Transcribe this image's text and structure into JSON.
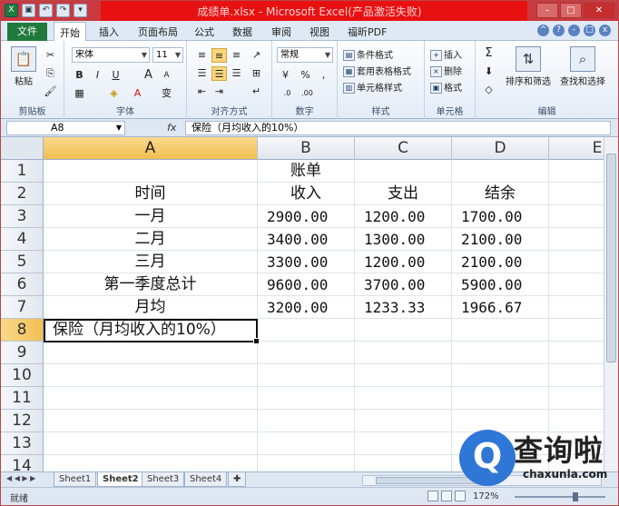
{
  "window": {
    "title": "成绩单.xlsx - Microsoft Excel(产品激活失败)",
    "min_glyph": "–",
    "max_glyph": "□",
    "close_glyph": "✕"
  },
  "qat": {
    "excel_icon": "X",
    "save_icon": "▣",
    "undo_icon": "↶",
    "redo_icon": "↷",
    "more_icon": "▾"
  },
  "tabs": {
    "file": "文件",
    "items": [
      "开始",
      "插入",
      "页面布局",
      "公式",
      "数据",
      "审阅",
      "视图",
      "福昕PDF"
    ],
    "active": "开始"
  },
  "ribbon": {
    "clipboard": {
      "paste": "粘贴",
      "label": "剪贴板"
    },
    "font": {
      "name": "宋体",
      "size": "11",
      "bold": "B",
      "italic": "I",
      "underline": "U",
      "grow": "A",
      "shrink": "A",
      "phonetic": "变",
      "label": "字体"
    },
    "alignment": {
      "label": "对齐方式"
    },
    "number": {
      "format": "常规",
      "percent": "%",
      "comma": ",",
      "label": "数字"
    },
    "styles": {
      "conditional": "条件格式",
      "table": "套用表格格式",
      "cell": "单元格样式",
      "label": "样式"
    },
    "cells": {
      "insert": "插入",
      "delete": "删除",
      "format": "格式",
      "label": "单元格"
    },
    "editing": {
      "sum": "Σ",
      "sort": "排序和筛选",
      "find": "查找和选择",
      "label": "编辑"
    }
  },
  "formula_bar": {
    "name_box": "A8",
    "fx": "fx",
    "content": "保险（月均收入的10%）"
  },
  "sheet": {
    "columns": [
      "A",
      "B",
      "C",
      "D",
      "E"
    ],
    "active_column": "A",
    "active_row": "8",
    "rows": [
      {
        "n": "1",
        "cells": [
          "",
          "账单",
          "",
          "",
          ""
        ]
      },
      {
        "n": "2",
        "cells": [
          "时间",
          "收入",
          "支出",
          "结余",
          ""
        ]
      },
      {
        "n": "3",
        "cells": [
          "一月",
          "2900.00",
          "1200.00",
          "1700.00",
          ""
        ]
      },
      {
        "n": "4",
        "cells": [
          "二月",
          "3400.00",
          "1300.00",
          "2100.00",
          ""
        ]
      },
      {
        "n": "5",
        "cells": [
          "三月",
          "3300.00",
          "1200.00",
          "2100.00",
          ""
        ]
      },
      {
        "n": "6",
        "cells": [
          "第一季度总计",
          "9600.00",
          "3700.00",
          "5900.00",
          ""
        ]
      },
      {
        "n": "7",
        "cells": [
          "月均",
          "3200.00",
          "1233.33",
          "1966.67",
          ""
        ]
      },
      {
        "n": "8",
        "cells": [
          "保险（月均收入的10%）",
          "",
          "",
          "",
          ""
        ]
      },
      {
        "n": "9",
        "cells": [
          "",
          "",
          "",
          "",
          ""
        ]
      },
      {
        "n": "10",
        "cells": [
          "",
          "",
          "",
          "",
          ""
        ]
      },
      {
        "n": "11",
        "cells": [
          "",
          "",
          "",
          "",
          ""
        ]
      },
      {
        "n": "12",
        "cells": [
          "",
          "",
          "",
          "",
          ""
        ]
      },
      {
        "n": "13",
        "cells": [
          "",
          "",
          "",
          "",
          ""
        ]
      },
      {
        "n": "14",
        "cells": [
          "",
          "",
          "",
          "",
          ""
        ]
      }
    ]
  },
  "sheet_tabs": {
    "items": [
      "Sheet1",
      "Sheet2",
      "Sheet3",
      "Sheet4"
    ],
    "active": "Sheet2",
    "nav": "◀ ◀ ▶ ▶"
  },
  "status": {
    "ready": "就绪",
    "zoom": "172%"
  },
  "watermark": {
    "glyph": "Q",
    "text": "查询啦",
    "url": "chaxunla.com"
  },
  "colors": {
    "title_bar": "#e81111",
    "file_tab": "#1f7a3b",
    "selection_header": "#f1bf52",
    "watermark_blue": "#2f77d6"
  }
}
